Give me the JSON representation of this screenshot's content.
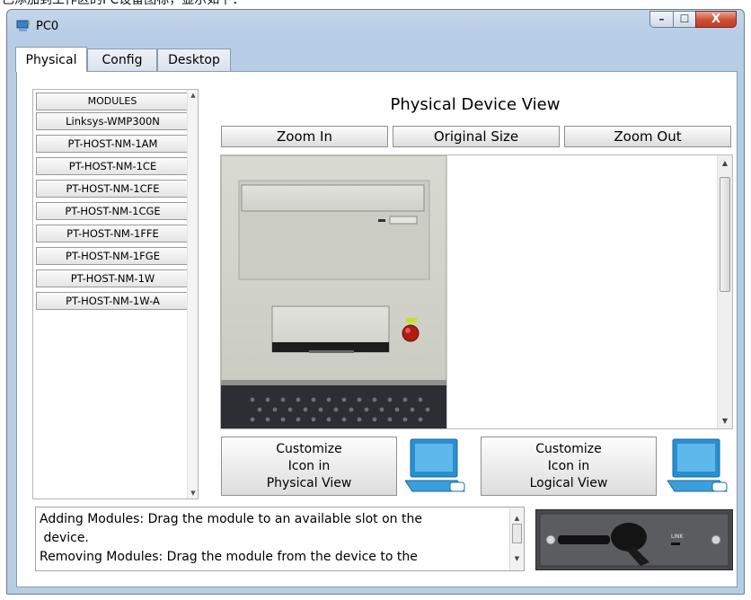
{
  "top_caption": "已添加到工作区的PC设备图标，显示如下：",
  "window": {
    "title": "PC0",
    "controls": {
      "minimize": "–",
      "maximize": "☐",
      "close": "X"
    }
  },
  "tabs": [
    {
      "label": "Physical",
      "active": true
    },
    {
      "label": "Config",
      "active": false
    },
    {
      "label": "Desktop",
      "active": false
    }
  ],
  "modules": {
    "header": "MODULES",
    "items": [
      "Linksys-WMP300N",
      "PT-HOST-NM-1AM",
      "PT-HOST-NM-1CE",
      "PT-HOST-NM-1CFE",
      "PT-HOST-NM-1CGE",
      "PT-HOST-NM-1FFE",
      "PT-HOST-NM-1FGE",
      "PT-HOST-NM-1W",
      "PT-HOST-NM-1W-A"
    ]
  },
  "physical_view": {
    "title": "Physical Device View",
    "zoom_in": "Zoom In",
    "original_size": "Original Size",
    "zoom_out": "Zoom Out"
  },
  "customize": {
    "physical": [
      "Customize",
      "Icon in",
      "Physical View"
    ],
    "logical": [
      "Customize",
      "Icon in",
      "Logical View"
    ]
  },
  "help_text": {
    "line1": "Adding Modules: Drag the module to an available slot on the",
    "line2": " device.",
    "line3": "Removing Modules: Drag the module from the device to the"
  },
  "module_label": "LINK",
  "icons": {
    "window": "pc-window-icon",
    "device": "pc-tower-image",
    "physical_pc": "computer-icon",
    "logical_pc": "computer-icon",
    "module": "wireless-module-image"
  },
  "colors": {
    "window_frame": "#b7cde6",
    "close_button": "#cc4e33",
    "tower": "#d2d3c9",
    "module": "#47494b"
  }
}
